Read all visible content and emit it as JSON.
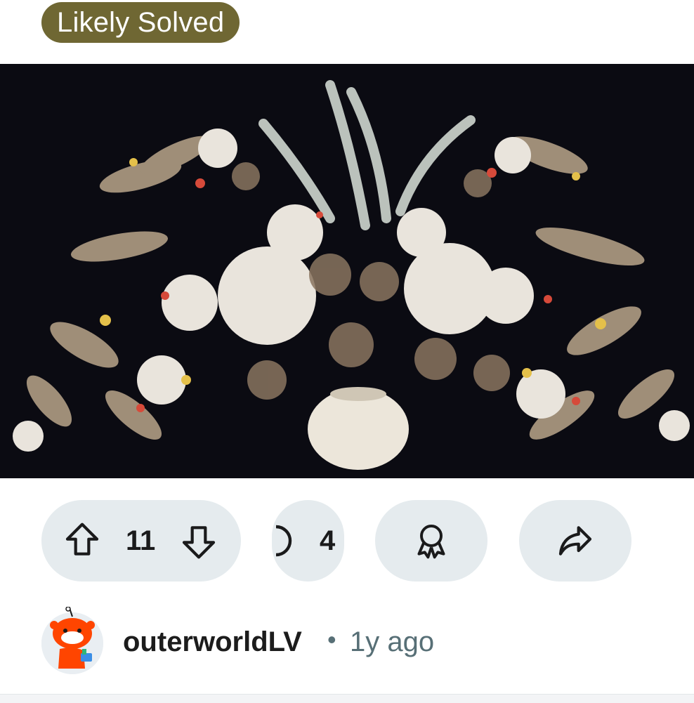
{
  "post": {
    "flair": {
      "label": "Likely Solved",
      "background_color": "#6f6733",
      "text_color": "#ffffff"
    },
    "image": {
      "subject": "arrangement of white and pale flowers, red and yellow blooms and leafy sprays in a white vase against a dark background"
    },
    "actions": {
      "vote_count": "11",
      "comment_count": "4",
      "pill_color": "#e5ebee",
      "icons": {
        "upvote": "arrow-up-outline-icon",
        "downvote": "arrow-down-outline-icon",
        "comments": "speech-bubble-icon",
        "award": "award-ribbon-icon",
        "share": "share-arrow-icon"
      }
    },
    "author": {
      "username": "outerworldLV",
      "separator": "•",
      "age": "1y ago",
      "avatar_icon": "snoo-avatar-icon"
    }
  }
}
